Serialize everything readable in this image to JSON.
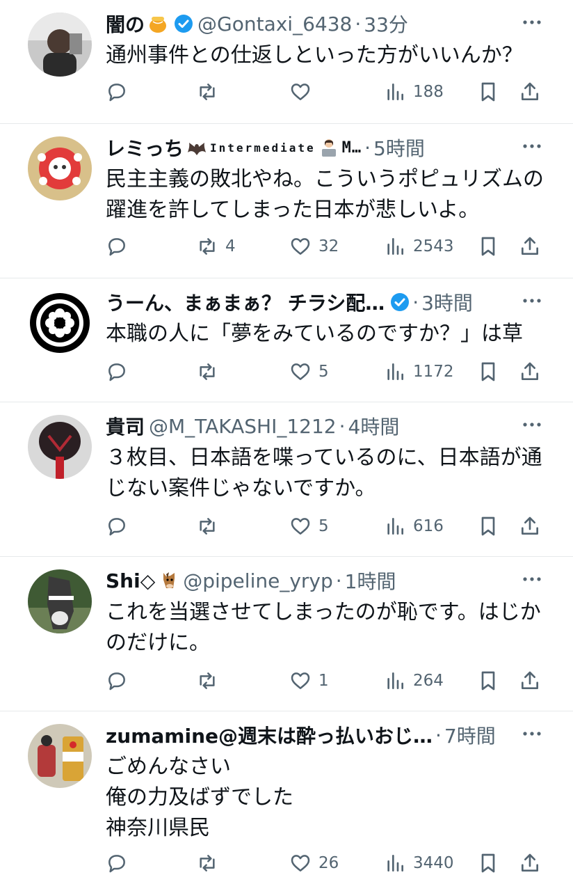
{
  "tweets": [
    {
      "name": "闇の",
      "handle": "@Gontaxi_6438",
      "sep": "·",
      "time": "33分",
      "lines": [
        "通州事件との仕返しといった方がいいんか？"
      ],
      "reply_count": "",
      "retweet_count": "",
      "like_count": "",
      "view_count": "188",
      "avatar_icon": "profile-photo"
    },
    {
      "name": "レミっち",
      "name_suffix": "Intermediate",
      "name_suffix2": "M…",
      "sep": "·",
      "time": "5時間",
      "lines": [
        "民主主義の敗北やね。こういうポピュリズムの",
        "躍進を許してしまった日本が悲しいよ。"
      ],
      "reply_count": "",
      "retweet_count": "4",
      "like_count": "32",
      "view_count": "2543",
      "avatar_icon": "character-illustration"
    },
    {
      "name": "うーん、まぁまぁ？ チラシ配…",
      "sep": "·",
      "time": "3時間",
      "lines": [
        "本職の人に「夢をみているのですか？」は草"
      ],
      "reply_count": "",
      "retweet_count": "",
      "like_count": "5",
      "view_count": "1172",
      "avatar_icon": "family-crest"
    },
    {
      "name": "貴司",
      "handle": "@M_TAKASHI_1212",
      "sep": "·",
      "time": "4時間",
      "lines": [
        "３枚目、日本語を喋っているのに、日本語が通",
        "じない案件じゃないですか。"
      ],
      "reply_count": "",
      "retweet_count": "",
      "like_count": "5",
      "view_count": "616",
      "avatar_icon": "mask-photo"
    },
    {
      "name": "Shi◇",
      "handle": "@pipeline_yryp",
      "sep": "·",
      "time": "1時間",
      "lines": [
        "これを当選させてしまったのが恥です。はじか",
        "のだけに。"
      ],
      "reply_count": "",
      "retweet_count": "",
      "like_count": "1",
      "view_count": "264",
      "avatar_icon": "horse-photo"
    },
    {
      "name": "zumamine@週末は酔っ払いおじ…",
      "sep": "·",
      "time": "7時間",
      "lines": [
        "ごめんなさい",
        "俺の力及ばずでした",
        "神奈川県民"
      ],
      "reply_count": "",
      "retweet_count": "",
      "like_count": "26",
      "view_count": "3440",
      "avatar_icon": "beer-can-photo"
    }
  ],
  "colors": {
    "text": "#0f1419",
    "secondary": "#536471",
    "verified": "#1d9bf0",
    "divider": "#e6e9eb"
  }
}
